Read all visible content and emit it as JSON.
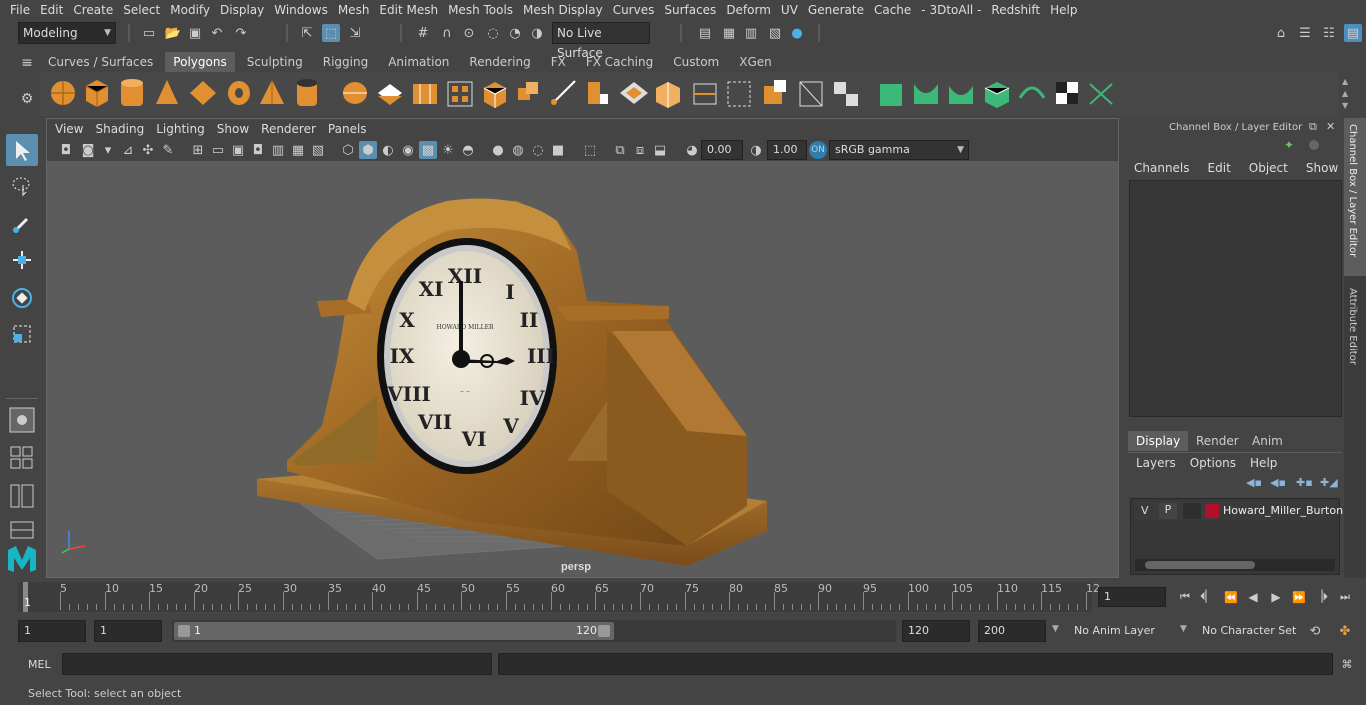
{
  "menubar": [
    "File",
    "Edit",
    "Create",
    "Select",
    "Modify",
    "Display",
    "Windows",
    "Mesh",
    "Edit Mesh",
    "Mesh Tools",
    "Mesh Display",
    "Curves",
    "Surfaces",
    "Deform",
    "UV",
    "Generate",
    "Cache",
    "- 3DtoAll -",
    "Redshift",
    "Help"
  ],
  "statusline": {
    "mode": "Modeling",
    "live_surface": "No Live Surface"
  },
  "shelf_tabs": [
    "Curves / Surfaces",
    "Polygons",
    "Sculpting",
    "Rigging",
    "Animation",
    "Rendering",
    "FX",
    "FX Caching",
    "Custom",
    "XGen"
  ],
  "shelf_active": "Polygons",
  "viewport": {
    "menu": [
      "View",
      "Shading",
      "Lighting",
      "Show",
      "Renderer",
      "Panels"
    ],
    "exposure": "0.00",
    "gamma": "1.00",
    "colorspace": "sRGB gamma",
    "camera_label": "persp",
    "clock_brand": "HOWARD MILLER"
  },
  "channelbox": {
    "title": "Channel Box / Layer Editor",
    "menu": [
      "Channels",
      "Edit",
      "Object",
      "Show"
    ]
  },
  "layer_editor": {
    "tabs": [
      "Display",
      "Render",
      "Anim"
    ],
    "active_tab": "Display",
    "menu": [
      "Layers",
      "Options",
      "Help"
    ],
    "layer": {
      "v": "V",
      "p": "P",
      "name": "Howard_Miller_Burton",
      "color": "#b0102a"
    }
  },
  "side_tabs": [
    "Channel Box / Layer Editor",
    "Attribute Editor"
  ],
  "timeline": {
    "ticks": [
      "5",
      "10",
      "15",
      "20",
      "25",
      "30",
      "35",
      "40",
      "45",
      "50",
      "55",
      "60",
      "65",
      "70",
      "75",
      "80",
      "85",
      "90",
      "95",
      "100",
      "105",
      "110",
      "115",
      "12"
    ],
    "start_marker": "1",
    "current_frame": "1"
  },
  "range": {
    "start": "1",
    "anim_start": "1",
    "slider_start": "1",
    "slider_end": "120",
    "end": "120",
    "anim_end": "200",
    "anim_layer": "No Anim Layer",
    "character_set": "No Character Set"
  },
  "cmdline": {
    "label": "MEL"
  },
  "helpline": {
    "text": "Select Tool: select an object"
  }
}
